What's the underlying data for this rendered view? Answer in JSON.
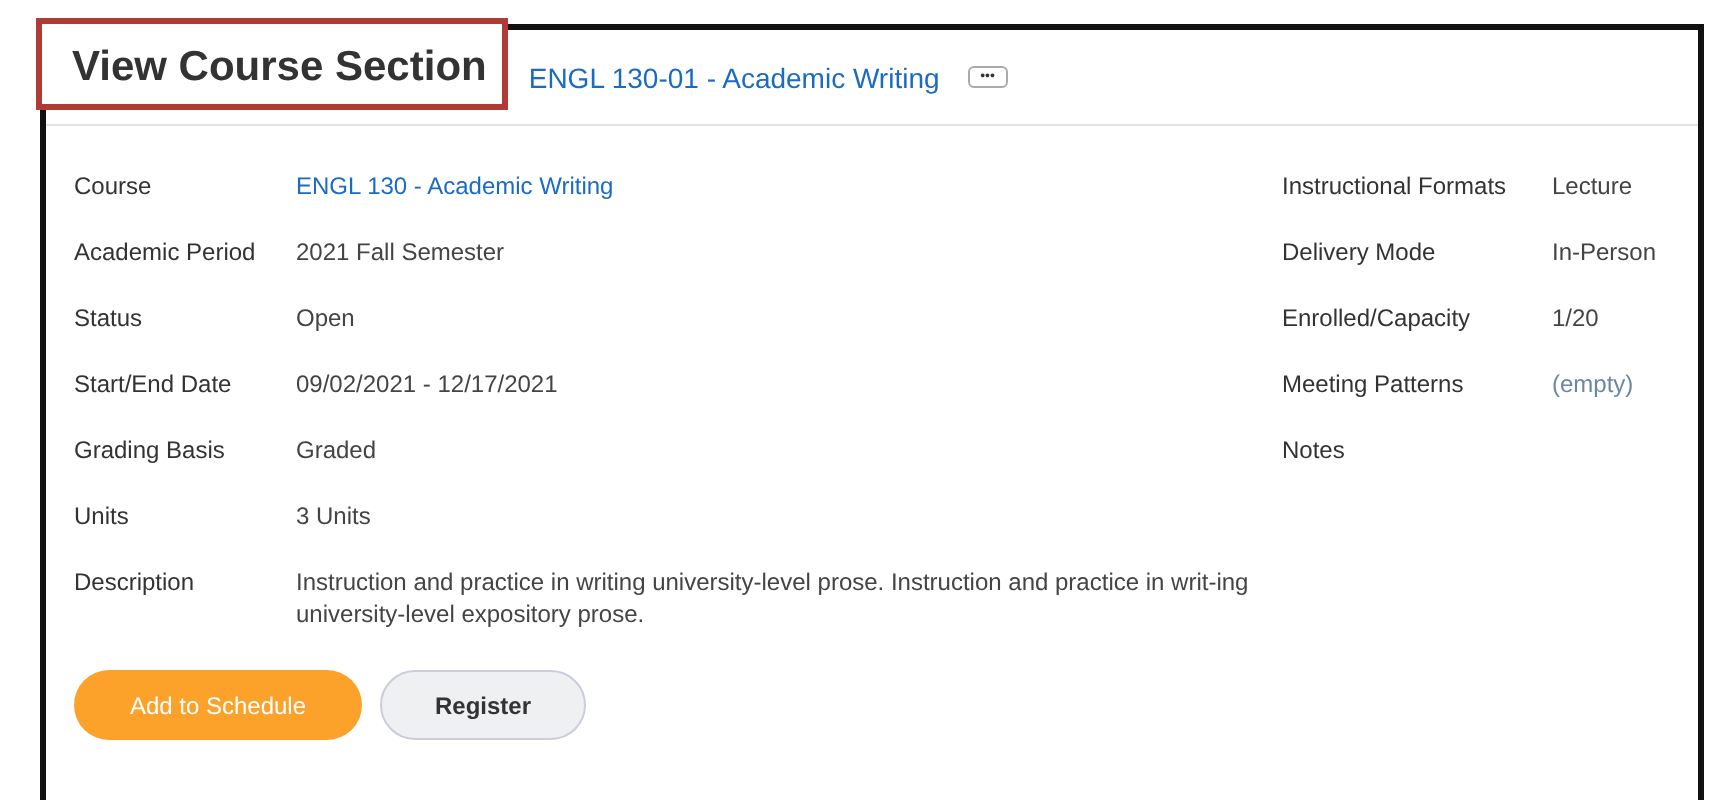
{
  "header": {
    "title": "View Course Section",
    "section_link": "ENGL 130-01 - Academic Writing",
    "more_button": "•••"
  },
  "left_fields": [
    {
      "label": "Course",
      "value": "ENGL 130 - Academic Writing",
      "kind": "link"
    },
    {
      "label": "Academic Period",
      "value": "2021 Fall Semester",
      "kind": "text"
    },
    {
      "label": "Status",
      "value": "Open",
      "kind": "text"
    },
    {
      "label": "Start/End Date",
      "value": "09/02/2021 - 12/17/2021",
      "kind": "text"
    },
    {
      "label": "Grading Basis",
      "value": "Graded",
      "kind": "text"
    },
    {
      "label": "Units",
      "value": "3 Units",
      "kind": "text"
    },
    {
      "label": "Description",
      "value": "Instruction and practice in writing university-level prose. Instruction and practice in writ-ing university-level expository prose.",
      "kind": "text"
    }
  ],
  "right_fields": [
    {
      "label": "Instructional Formats",
      "value": "Lecture",
      "kind": "text"
    },
    {
      "label": "Delivery Mode",
      "value": "In-Person",
      "kind": "text"
    },
    {
      "label": "Enrolled/Capacity",
      "value": "1/20",
      "kind": "text"
    },
    {
      "label": "Meeting Patterns",
      "value": "(empty)",
      "kind": "empty"
    },
    {
      "label": "Notes",
      "kind": "none"
    }
  ],
  "buttons": [
    {
      "label": "Add to Schedule",
      "kind": "primary"
    },
    {
      "label": "Register",
      "kind": "secondary"
    }
  ]
}
